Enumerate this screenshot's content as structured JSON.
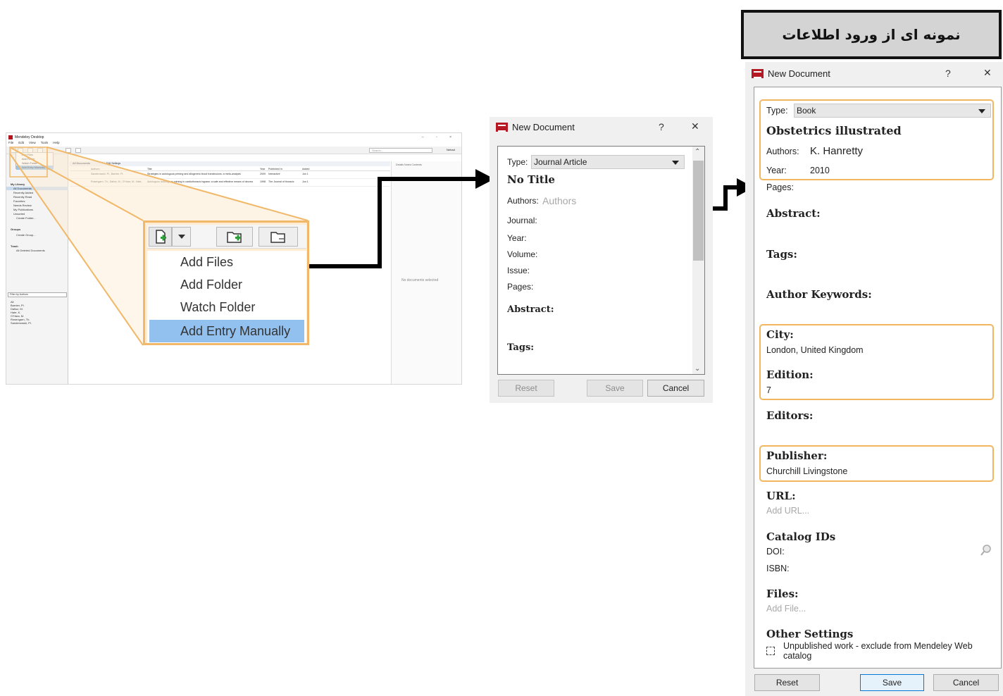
{
  "banner": {
    "text": "نمونه ای از ورود اطلاعات"
  },
  "mini_window": {
    "title": "Mendeley Desktop",
    "menu": [
      "File",
      "Edit",
      "View",
      "Tools",
      "Help"
    ],
    "window_controls": "– ▫ ×",
    "search_placeholder": "Search...",
    "user": "Nehad",
    "add_menu": [
      "Add Files",
      "Add Folder",
      "Watch Folder",
      "Add Entry Manually"
    ],
    "sidebar": {
      "my_library": "My Library",
      "items": [
        "All Documents",
        "Recently Added",
        "Recently Read",
        "Favorites",
        "Needs Review",
        "My Publications",
        "Unsorted",
        "Create Folder..."
      ],
      "groups": "Groups",
      "create_group": "Create Group...",
      "trash": "Trash",
      "all_deleted": "All Deleted Documents",
      "filter": "Filter by Authors",
      "authors": [
        "All",
        "Barnier, Pl.",
        "Dalloz, M.",
        "Hate, K.",
        "O'Hara, M.",
        "Rosengarn, Th.",
        "Sanderowski, Pl."
      ]
    },
    "doc_tabs": [
      "All Documents",
      "Edit Settings"
    ],
    "columns": [
      "Authors",
      "Title",
      "Year",
      "Published In",
      "Added"
    ],
    "rows": [
      {
        "authors": "Sanderowski, Pl., Barnier, Pl.",
        "title": "Strategies in autologous priming and allogeneic blood transfusions: a meta-analysis",
        "year": "2009",
        "pub": "Interactive",
        "added": "Jun 1"
      },
      {
        "authors": "Rosengarn, Th., Dalloz, M., O'Hara, M., Hate,",
        "title": "Autologous autologous priming in cardiothoracic bypass: a safe and effective means of decreasing hemodilution and blood requirements",
        "year": "1998",
        "pub": "The Journal of thoracic",
        "added": "Jun 1"
      }
    ],
    "detail_tabs": "Details   Notes   Contents",
    "no_docs": "No documents selected",
    "side_toggle": "Related"
  },
  "zoom_menu": [
    "Add Files",
    "Add Folder",
    "Watch Folder",
    "Add Entry Manually"
  ],
  "dialog1": {
    "title": "New Document",
    "help": "?",
    "close": "✕",
    "type_label": "Type:",
    "type_value": "Journal Article",
    "title_value": "No Title",
    "authors_label": "Authors:",
    "authors_placeholder": "Authors",
    "journal_label": "Journal:",
    "year_label": "Year:",
    "volume_label": "Volume:",
    "issue_label": "Issue:",
    "pages_label": "Pages:",
    "abstract_label": "Abstract:",
    "tags_label": "Tags:",
    "reset": "Reset",
    "save": "Save",
    "cancel": "Cancel"
  },
  "dialog2": {
    "title": "New Document",
    "help": "?",
    "close": "✕",
    "type_label": "Type:",
    "type_value": "Book",
    "title_value": "Obstetrics illustrated",
    "authors_label": "Authors:",
    "authors_value": "K. Hanretty",
    "year_label": "Year:",
    "year_value": "2010",
    "pages_label": "Pages:",
    "abstract_label": "Abstract:",
    "tags_label": "Tags:",
    "keywords_label": "Author Keywords:",
    "city_label": "City:",
    "city_value": "London, United Kingdom",
    "edition_label": "Edition:",
    "edition_value": "7",
    "editors_label": "Editors:",
    "publisher_label": "Publisher:",
    "publisher_value": "Churchill Livingstone",
    "url_label": "URL:",
    "url_placeholder": "Add URL...",
    "catalog_label": "Catalog IDs",
    "doi_label": "DOI:",
    "isbn_label": "ISBN:",
    "files_label": "Files:",
    "files_placeholder": "Add File...",
    "other_label": "Other Settings",
    "unpublished_line1": "Unpublished work - exclude from Mendeley Web",
    "unpublished_line2": "catalog",
    "reset": "Reset",
    "save": "Save",
    "cancel": "Cancel"
  }
}
